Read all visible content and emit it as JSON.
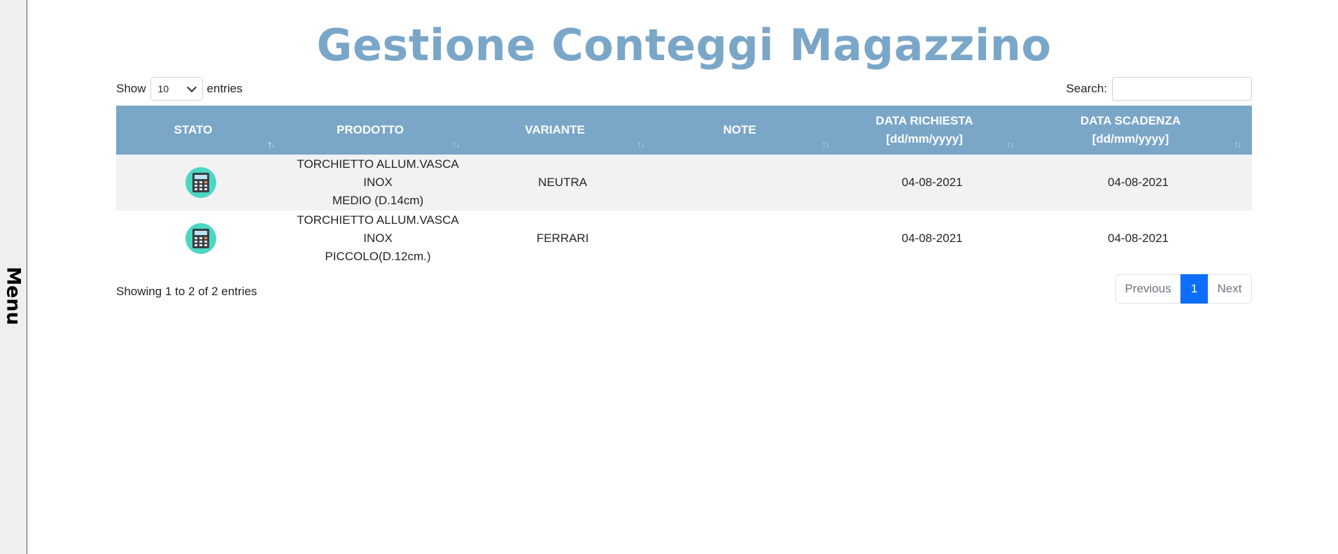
{
  "menu": {
    "label": "Menu"
  },
  "title": "Gestione Conteggi Magazzino",
  "length_control": {
    "show_label": "Show",
    "selected": "10",
    "entries_label": "entries"
  },
  "search": {
    "label": "Search:",
    "value": ""
  },
  "table": {
    "columns": [
      {
        "line1": "STATO",
        "line2": ""
      },
      {
        "line1": "PRODOTTO",
        "line2": ""
      },
      {
        "line1": "VARIANTE",
        "line2": ""
      },
      {
        "line1": "NOTE",
        "line2": ""
      },
      {
        "line1": "DATA RICHIESTA",
        "line2": "[dd/mm/yyyy]"
      },
      {
        "line1": "DATA SCADENZA",
        "line2": "[dd/mm/yyyy]"
      }
    ],
    "sort_icon": "↑↓",
    "rows": [
      {
        "stato_icon": "calculator-icon",
        "prodotto_line1": "TORCHIETTO ALLUM.VASCA INOX",
        "prodotto_line2": "MEDIO (D.14cm)",
        "variante": "NEUTRA",
        "note": "",
        "data_richiesta": "04-08-2021",
        "data_scadenza": "04-08-2021"
      },
      {
        "stato_icon": "calculator-icon",
        "prodotto_line1": "TORCHIETTO ALLUM.VASCA INOX",
        "prodotto_line2": "PICCOLO(D.12cm.)",
        "variante": "FERRARI",
        "note": "",
        "data_richiesta": "04-08-2021",
        "data_scadenza": "04-08-2021"
      }
    ]
  },
  "info": "Showing 1 to 2 of 2 entries",
  "pagination": {
    "previous": "Previous",
    "current": "1",
    "next": "Next"
  },
  "colors": {
    "header_bg": "#7aa6c8",
    "title": "#7aa6c8",
    "icon_bg": "#4dd6c2",
    "active_page": "#0d6efd"
  }
}
